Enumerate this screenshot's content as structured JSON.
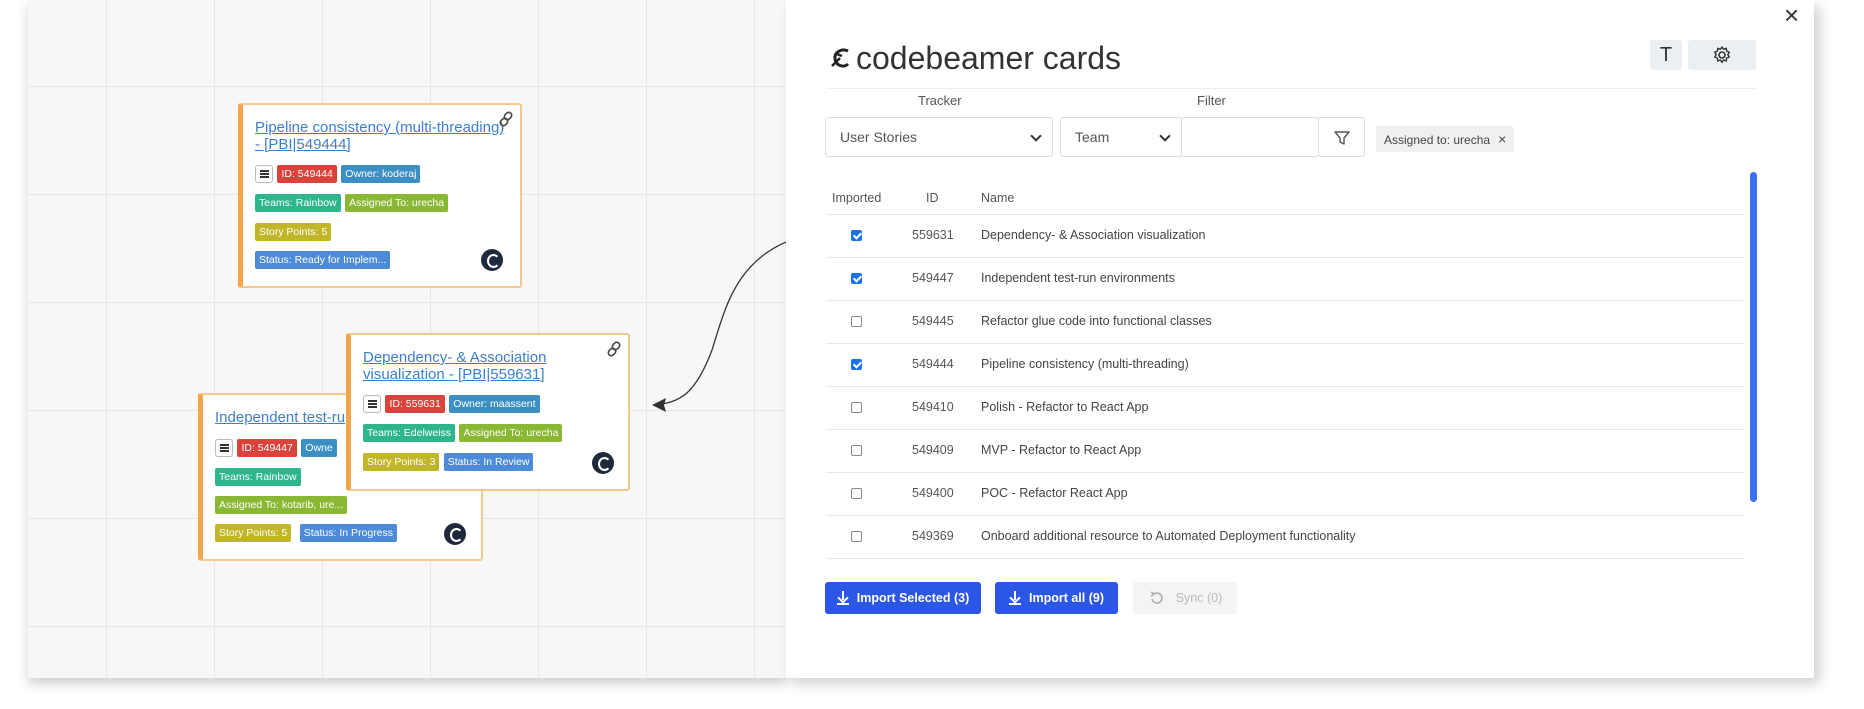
{
  "panel": {
    "title": "codebeamer cards",
    "text_button": "T",
    "close_label": "×"
  },
  "filters": {
    "tracker_label": "Tracker",
    "filter_label": "Filter",
    "tracker_value": "User Stories",
    "filter_field": "Team",
    "filter_value": "",
    "chip_label": "Assigned to: urecha",
    "chip_remove": "×"
  },
  "table": {
    "headers": {
      "imported": "Imported",
      "id": "ID",
      "name": "Name"
    },
    "rows": [
      {
        "checked": true,
        "id": "559631",
        "name": "Dependency- & Association visualization"
      },
      {
        "checked": true,
        "id": "549447",
        "name": "Independent test-run environments"
      },
      {
        "checked": false,
        "id": "549445",
        "name": "Refactor glue code into functional classes"
      },
      {
        "checked": true,
        "id": "549444",
        "name": "Pipeline consistency (multi-threading)"
      },
      {
        "checked": false,
        "id": "549410",
        "name": "Polish - Refactor to React App"
      },
      {
        "checked": false,
        "id": "549409",
        "name": "MVP - Refactor to React App"
      },
      {
        "checked": false,
        "id": "549400",
        "name": "POC - Refactor React App"
      },
      {
        "checked": false,
        "id": "549369",
        "name": "Onboard additional resource to Automated Deployment functionality"
      }
    ]
  },
  "actions": {
    "import_selected": "Import Selected (3)",
    "import_all": "Import all (9)",
    "sync": "Sync (0)"
  },
  "cards": {
    "pipeline": {
      "title": "Pipeline consistency (multi-threading) - [PBI|549444]",
      "id": "ID: 549444",
      "owner": "Owner: koderaj",
      "teams": "Teams: Rainbow",
      "assigned": "Assigned To: urecha",
      "points": "Story Points: 5",
      "status": "Status: Ready for Implem..."
    },
    "dependency": {
      "title": "Dependency- & Association visualization - [PBI|559631]",
      "id": "ID: 559631",
      "owner": "Owner: maassent",
      "teams": "Teams: Edelweiss",
      "assigned": "Assigned To: urecha",
      "points": "Story Points: 3",
      "status": "Status: In Review"
    },
    "independent": {
      "title": "Independent test-ru",
      "id": "ID: 549447",
      "owner": "Owne",
      "teams": "Teams: Rainbow",
      "assigned": "Assigned To: kotarib, ure...",
      "points": "Story Points: 5",
      "status": "Status: In Progress"
    }
  },
  "colors": {
    "primary": "#2c56e6",
    "card_border": "#f6a54a",
    "id_badge": "#d9433c"
  }
}
